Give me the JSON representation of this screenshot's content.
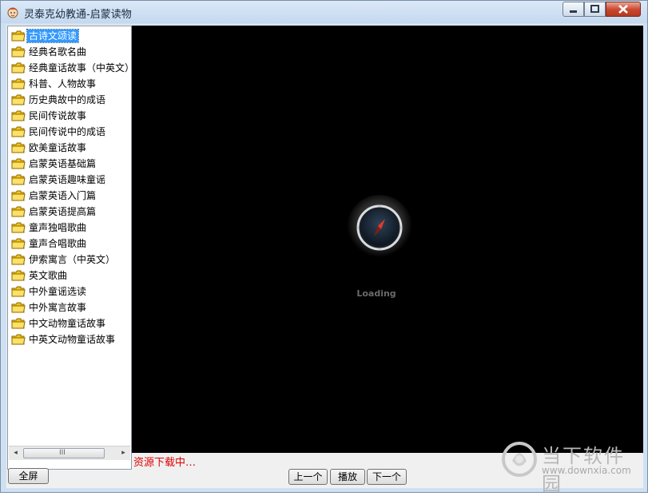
{
  "window": {
    "title": "灵泰克幼教通-启蒙读物",
    "icons": {
      "app": "child-face-icon",
      "minimize": "minimize-icon",
      "maximize": "maximize-icon",
      "close": "close-icon"
    }
  },
  "tree": {
    "items": [
      {
        "label": "古诗文颂读",
        "selected": true
      },
      {
        "label": "经典名歌名曲"
      },
      {
        "label": "经典童话故事（中英文）"
      },
      {
        "label": "科普、人物故事"
      },
      {
        "label": "历史典故中的成语"
      },
      {
        "label": "民间传说故事"
      },
      {
        "label": "民间传说中的成语"
      },
      {
        "label": "欧美童话故事"
      },
      {
        "label": "启蒙英语基础篇"
      },
      {
        "label": "启蒙英语趣味童谣"
      },
      {
        "label": "启蒙英语入门篇"
      },
      {
        "label": "启蒙英语提高篇"
      },
      {
        "label": "童声独唱歌曲"
      },
      {
        "label": "童声合唱歌曲"
      },
      {
        "label": "伊索寓言（中英文）"
      },
      {
        "label": "英文歌曲"
      },
      {
        "label": "中外童谣选读"
      },
      {
        "label": "中外寓言故事"
      },
      {
        "label": "中文动物童话故事"
      },
      {
        "label": "中英文动物童话故事"
      }
    ],
    "item_icon": "folder-icon",
    "scroll_left": "◂",
    "scroll_right": "▸",
    "scroll_grip": "III"
  },
  "player": {
    "loading_text": "Loading",
    "spinner_icon": "compass-icon"
  },
  "status_text": "资源下载中…",
  "buttons": {
    "fullscreen": "全屏",
    "prev": "上一个",
    "play": "播放",
    "next": "下一个"
  },
  "watermark": {
    "name": "当下软件园",
    "url": "www.downxia.com",
    "logo_icon": "downxia-logo-icon"
  },
  "colors": {
    "selection": "#3399ff",
    "status_text": "#e00000",
    "player_bg": "#000000",
    "close_button": "#c9452b"
  }
}
